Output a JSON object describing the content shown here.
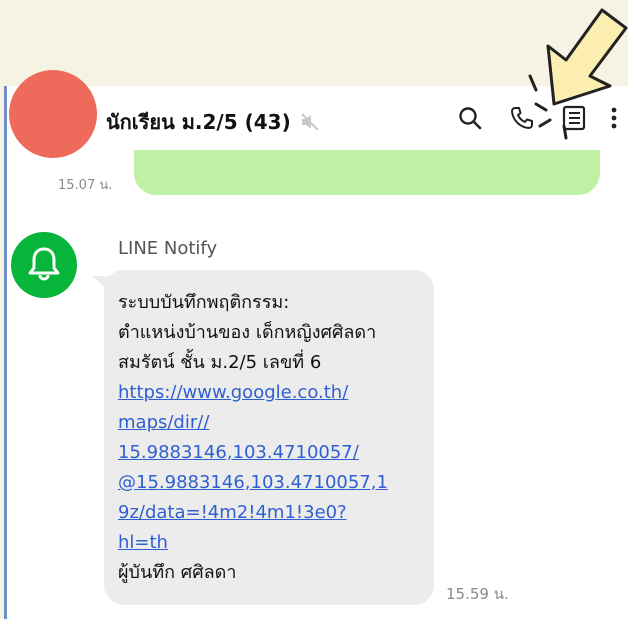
{
  "header": {
    "group_name": "นักเรียน ม.2/5 (43)",
    "icons": [
      "muted-speaker-icon",
      "search-icon",
      "phone-icon",
      "notes-icon",
      "more-vertical-icon"
    ]
  },
  "previous_message": {
    "time": "15.07 น."
  },
  "message": {
    "sender": "LINE Notify",
    "lines": [
      "ระบบบันทึกพฤติกรรม:",
      "ตำแหน่งบ้านของ เด็กหญิงศศิลดา",
      "สมรัตน์ ชั้น ม.2/5 เลขที่ 6"
    ],
    "link_lines": [
      "https://www.google.co.th/",
      "maps/dir//",
      "15.9883146,103.4710057/",
      "@15.9883146,103.4710057,1",
      "9z/data=!4m2!4m1!3e0?",
      "hl=th"
    ],
    "footer": "ผู้บันทึก ศศิลดา",
    "time": "15.59 น."
  },
  "colors": {
    "avatar_red": "#ee6a5a",
    "line_green": "#07b53b",
    "bubble_green": "#bff0a3",
    "bubble_gray": "#ececec",
    "link_blue": "#2f5fd0",
    "annotation_yellow": "#fbeeb0"
  }
}
